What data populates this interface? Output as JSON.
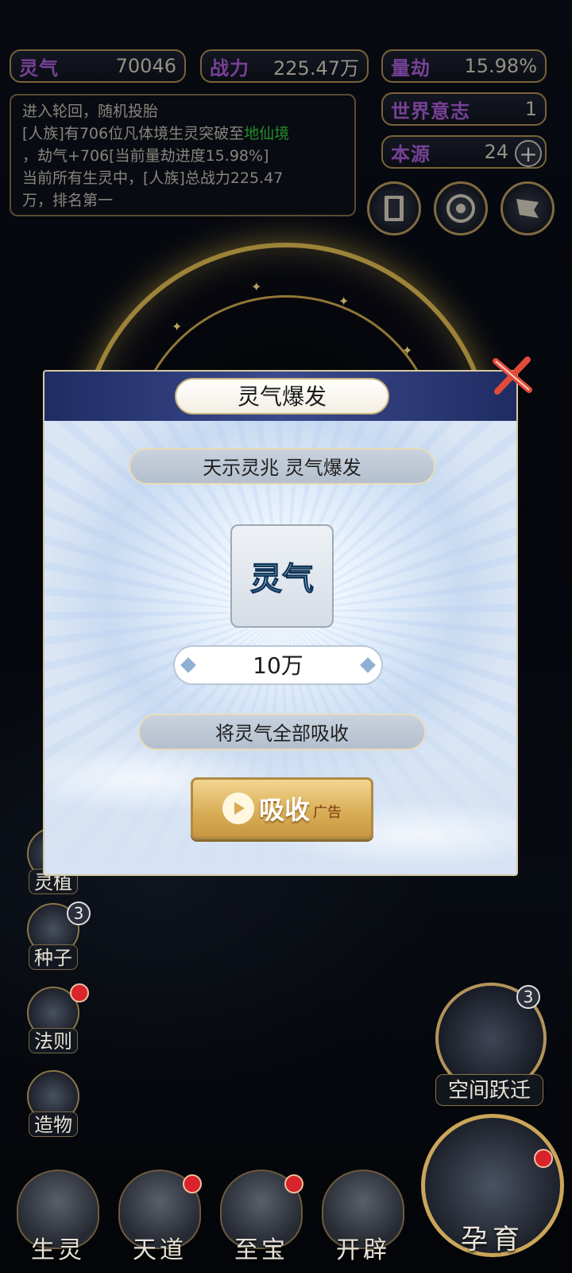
{
  "stats": {
    "lingqi": {
      "label": "灵气",
      "value": "70046"
    },
    "zhanli": {
      "label": "战力",
      "value": "225.47万"
    },
    "liangjie": {
      "label": "量劫",
      "value": "15.98%"
    },
    "shijie": {
      "label": "世界意志",
      "value": "1"
    },
    "benyuan": {
      "label": "本源",
      "value": "24"
    }
  },
  "log": {
    "line1": "进入轮回，随机投胎",
    "line2_pre": "[人族]有706位凡体境生灵突破至",
    "line2_hl": "地仙境",
    "line3": "，劫气+706[当前量劫进度15.98%]",
    "line4": "当前所有生灵中，[人族]总战力225.47",
    "line5": "万，排名第一"
  },
  "side_menu": [
    {
      "label": "灵植"
    },
    {
      "label": "种子",
      "badge": "3"
    },
    {
      "label": "法则"
    },
    {
      "label": "造物"
    }
  ],
  "space_jump": {
    "label": "空间跃迁",
    "badge": "3"
  },
  "bottom_nav": [
    {
      "label": "生灵"
    },
    {
      "label": "天道"
    },
    {
      "label": "至宝"
    },
    {
      "label": "开辟"
    }
  ],
  "incubate": {
    "label": "孕育"
  },
  "modal": {
    "title": "灵气爆发",
    "subtitle": "天示灵兆 灵气爆发",
    "item_name": "灵气",
    "amount": "10万",
    "description": "将灵气全部吸收",
    "absorb_label": "吸收",
    "ad_label": "广告"
  },
  "colors": {
    "accent_gold": "#d9b64f",
    "stat_label_purple": "#a45ad0",
    "highlight_green": "#33c23a",
    "modal_header_blue": "#2b3b7a"
  }
}
